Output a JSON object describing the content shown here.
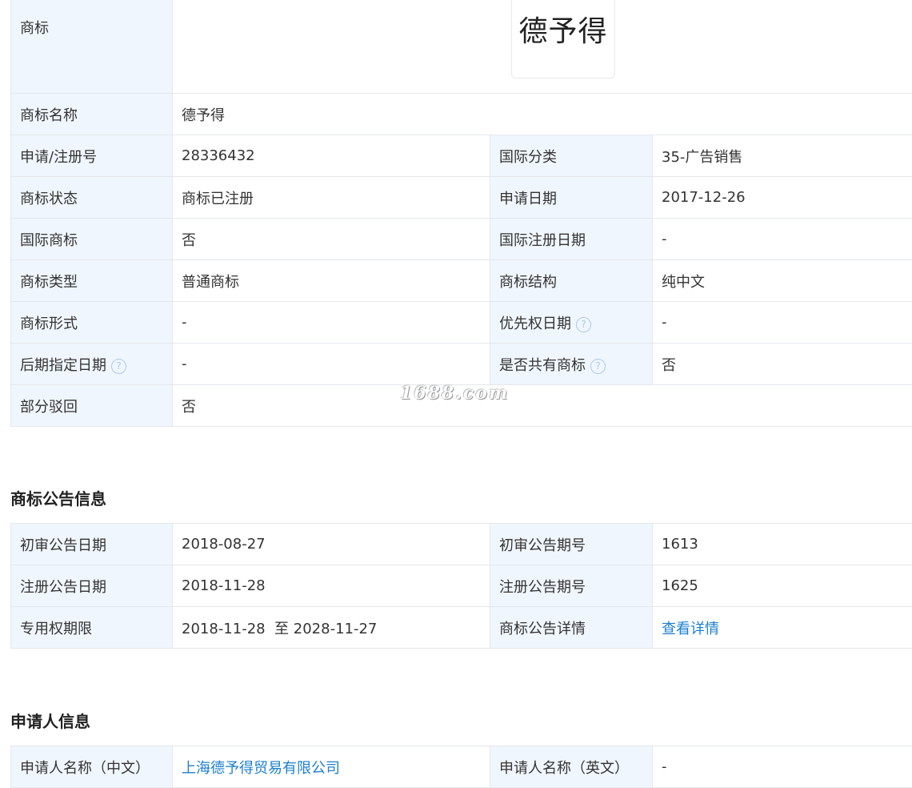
{
  "trademark": {
    "logo_label": "商标",
    "logo_text": "德予得",
    "rows": [
      {
        "k1": "商标名称",
        "v1": "德予得"
      },
      {
        "k1": "申请/注册号",
        "v1": "28336432",
        "k2": "国际分类",
        "v2": "35-广告销售"
      },
      {
        "k1": "商标状态",
        "v1": "商标已注册",
        "k2": "申请日期",
        "v2": "2017-12-26"
      },
      {
        "k1": "国际商标",
        "v1": "否",
        "k2": "国际注册日期",
        "v2": "-"
      },
      {
        "k1": "商标类型",
        "v1": "普通商标",
        "k2": "商标结构",
        "v2": "纯中文"
      },
      {
        "k1": "商标形式",
        "v1": "-",
        "k2": "优先权日期",
        "v2": "-"
      },
      {
        "k1": "后期指定日期",
        "v1": "-",
        "k2": "是否共有商标",
        "v2": "否"
      },
      {
        "k1": "部分驳回",
        "v1": "否"
      }
    ],
    "help_glyph": "?"
  },
  "watermark": "1688.com",
  "announcement": {
    "title": "商标公告信息",
    "rows": [
      {
        "k1": "初审公告日期",
        "v1": "2018-08-27",
        "k2": "初审公告期号",
        "v2": "1613"
      },
      {
        "k1": "注册公告日期",
        "v1": "2018-11-28",
        "k2": "注册公告期号",
        "v2": "1625"
      },
      {
        "k1": "专用权期限",
        "v1": "2018-11-28  至 2028-11-27",
        "k2": "商标公告详情",
        "v2": "查看详情"
      }
    ]
  },
  "applicant": {
    "title": "申请人信息",
    "rows": [
      {
        "k1": "申请人名称（中文）",
        "v1": "上海德予得贸易有限公司",
        "k2": "申请人名称（英文）",
        "v2": "-"
      }
    ]
  },
  "colors": {
    "label_bg": "#f0f6fd",
    "border": "#e4e7ed",
    "link": "#1b7fcf",
    "help_icon": "#a9c9ec"
  }
}
